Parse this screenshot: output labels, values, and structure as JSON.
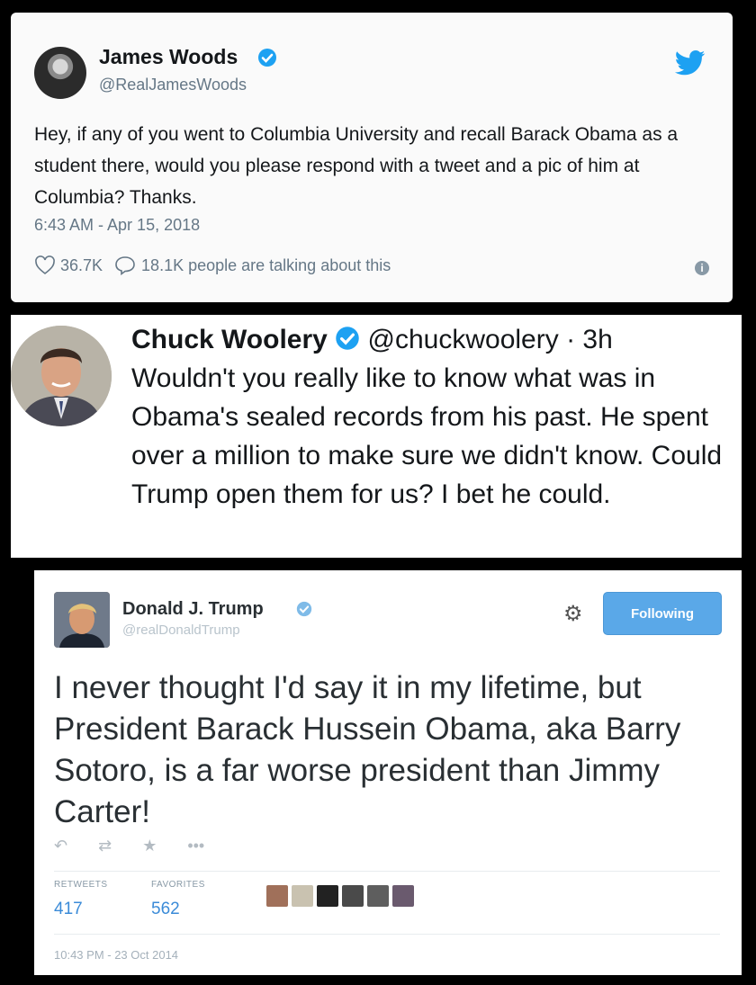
{
  "tweet1": {
    "name": "James Woods",
    "handle": "@RealJamesWoods",
    "text": "Hey, if any of you went to Columbia University and recall Barack Obama as a student there, would you please respond with a tweet and a pic of him at Columbia? Thanks.",
    "timestamp": "6:43 AM - Apr 15, 2018",
    "likes": "36.7K",
    "talking": "18.1K people are talking about this",
    "icons": [
      "verified-badge",
      "twitter-bird",
      "heart",
      "speech-bubble",
      "info"
    ]
  },
  "tweet2": {
    "name": "Chuck Woolery",
    "handle": "@chuckwoolery",
    "age": "· 3h",
    "text": "Wouldn't you really like to know what was in Obama's sealed records from his past. He spent over a million to make sure we didn't know. Could Trump open them for us? I bet he could."
  },
  "tweet3": {
    "name": "Donald J. Trump",
    "handle": "@realDonaldTrump",
    "follow_label": "Following",
    "text": "I never thought I'd say it in my lifetime, but President Barack Hussein Obama, aka Barry Sotoro, is a far worse president than Jimmy Carter!",
    "retweets_label": "RETWEETS",
    "retweets": "417",
    "favorites_label": "FAVORITES",
    "favorites": "562",
    "timestamp": "10:43 PM - 23 Oct 2014"
  },
  "colors": {
    "twitter_blue": "#1da1f2",
    "follow_blue": "#5aa8e8",
    "gray_text": "#657786"
  }
}
